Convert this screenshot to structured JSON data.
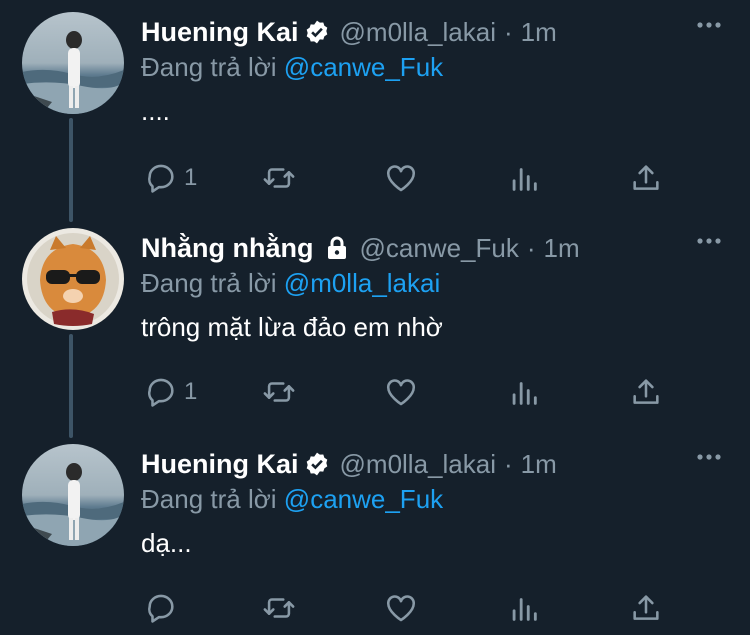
{
  "tweets": [
    {
      "name": "Huening Kai",
      "verified": true,
      "handle": "@m0lla_lakai",
      "separator": "·",
      "time": "1m",
      "reply_prefix": "Đang trả lời",
      "reply_to": "@canwe_Fuk",
      "text": "....",
      "reply_count": "1",
      "retweet_count": "",
      "like_count": ""
    },
    {
      "name": "Nhằng nhằng",
      "protected": true,
      "handle": "@canwe_Fuk",
      "separator": "·",
      "time": "1m",
      "reply_prefix": "Đang trả lời",
      "reply_to": "@m0lla_lakai",
      "text": "trông mặt lừa đảo em nhờ",
      "reply_count": "1",
      "retweet_count": "",
      "like_count": ""
    },
    {
      "name": "Huening Kai",
      "verified": true,
      "handle": "@m0lla_lakai",
      "separator": "·",
      "time": "1m",
      "reply_prefix": "Đang trả lời",
      "reply_to": "@canwe_Fuk",
      "text": "dạ...",
      "reply_count": "",
      "retweet_count": "",
      "like_count": ""
    }
  ],
  "colors": {
    "background": "#15202b",
    "secondary_text": "#8899a6",
    "accent": "#1da1f2",
    "thread_line": "#3d5466"
  },
  "icons": {
    "reply": "reply-icon",
    "retweet": "retweet-icon",
    "like": "heart-icon",
    "analytics": "analytics-icon",
    "share": "share-icon",
    "more": "more-icon",
    "verified": "verified-badge-icon",
    "protected": "lock-icon"
  }
}
